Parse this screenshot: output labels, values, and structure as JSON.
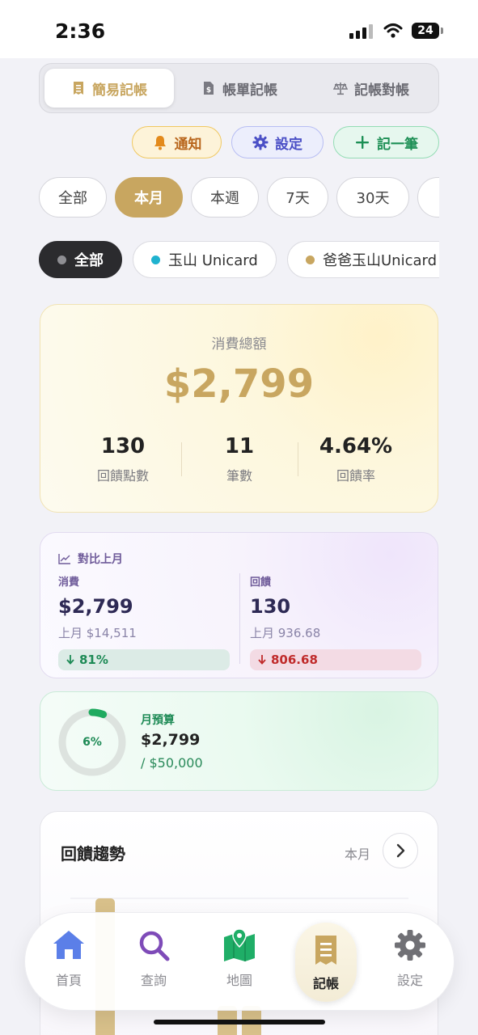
{
  "status_bar": {
    "time": "2:36",
    "battery": "24"
  },
  "mode_tabs": [
    {
      "label": "簡易記帳",
      "icon": "receipt-icon",
      "active": true
    },
    {
      "label": "帳單記帳",
      "icon": "bill-icon",
      "active": false
    },
    {
      "label": "記帳對帳",
      "icon": "scale-icon",
      "active": false
    }
  ],
  "actions": {
    "notify": "通知",
    "settings": "設定",
    "add": "記一筆"
  },
  "ranges": [
    "全部",
    "本月",
    "本週",
    "7天",
    "30天"
  ],
  "active_range": "本月",
  "cards": [
    {
      "label": "全部",
      "color": "#8e8e93",
      "active": true
    },
    {
      "label": "玉山 Unicard",
      "color": "#1fb2cf",
      "active": false
    },
    {
      "label": "爸爸玉山Unicard",
      "color": "#c8a660",
      "active": false
    }
  ],
  "summary": {
    "title": "消費總額",
    "amount": "$2,799",
    "stats": [
      {
        "value": "130",
        "label": "回饋點數"
      },
      {
        "value": "11",
        "label": "筆數"
      },
      {
        "value": "4.64%",
        "label": "回饋率"
      }
    ]
  },
  "compare": {
    "title": "對比上月",
    "spend": {
      "label": "消費",
      "value": "$2,799",
      "prev": "上月 $14,511",
      "change": "81%",
      "direction": "down"
    },
    "reward": {
      "label": "回饋",
      "value": "130",
      "prev": "上月 936.68",
      "change": "806.68",
      "direction": "down"
    }
  },
  "budget": {
    "percent_text": "6%",
    "progress": 0.06,
    "label": "月預算",
    "spent": "$2,799",
    "total": "/ $50,000"
  },
  "trend": {
    "title": "回饋趨勢",
    "range": "本月"
  },
  "tabbar": [
    {
      "label": "首頁",
      "icon": "home-icon"
    },
    {
      "label": "查詢",
      "icon": "search-icon"
    },
    {
      "label": "地圖",
      "icon": "map-icon"
    },
    {
      "label": "記帳",
      "icon": "receipt-icon"
    },
    {
      "label": "設定",
      "icon": "gear-icon"
    }
  ],
  "colors": {
    "gold": "#c8a660",
    "green": "#1d8a55",
    "red": "#c02b2b",
    "purple": "#6e5a99"
  }
}
